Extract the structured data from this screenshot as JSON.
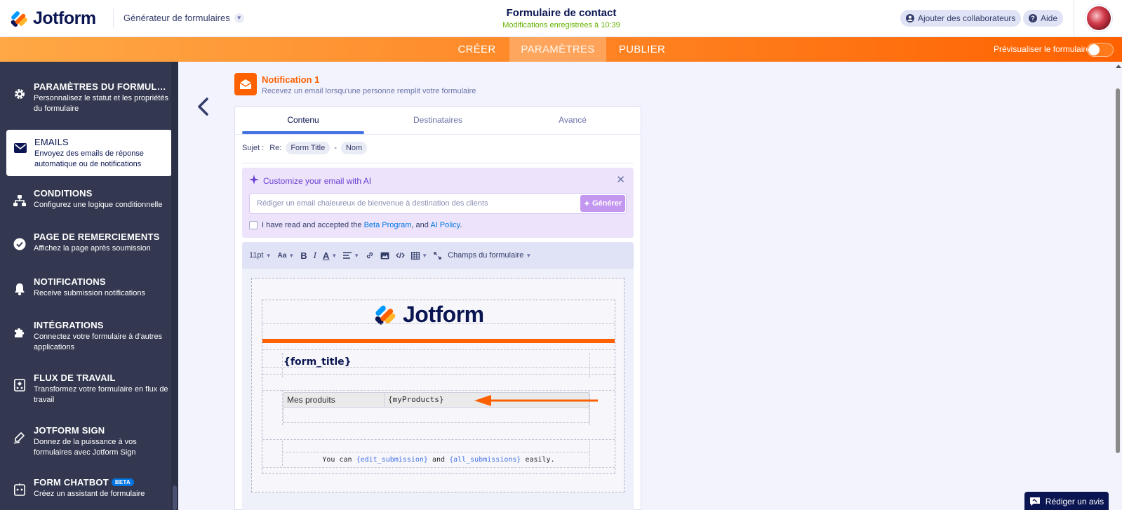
{
  "header": {
    "brand": "Jotform",
    "builder_menu": "Générateur de formulaires",
    "form_title": "Formulaire de contact",
    "saved_status": "Modifications enregistrées à 10:39",
    "add_collaborators": "Ajouter des collaborateurs",
    "help": "Aide"
  },
  "nav": {
    "tabs": [
      "CRÉER",
      "PARAMÈTRES",
      "PUBLIER"
    ],
    "active_tab": "PARAMÈTRES",
    "preview_label": "Prévisualiser le formulaire",
    "preview_enabled": false
  },
  "sidebar": {
    "items": [
      {
        "title": "PARAMÈTRES DU FORMULAIRE",
        "desc": "Personnalisez le statut et les propriétés du formulaire",
        "icon": "gear-icon"
      },
      {
        "title": "EMAILS",
        "desc": "Envoyez des emails de réponse automatique ou de notifications",
        "icon": "envelope-icon",
        "active": true
      },
      {
        "title": "CONDITIONS",
        "desc": "Configurez une logique conditionnelle",
        "icon": "sitemap-icon"
      },
      {
        "title": "PAGE DE REMERCIEMENTS",
        "desc": "Affichez la page après soumission",
        "icon": "check-circle-icon"
      },
      {
        "title": "NOTIFICATIONS",
        "desc": "Receive submission notifications",
        "icon": "bell-icon"
      },
      {
        "title": "INTÉGRATIONS",
        "desc": "Connectez votre formulaire à d'autres applications",
        "icon": "puzzle-icon"
      },
      {
        "title": "FLUX DE TRAVAIL",
        "desc": "Transformez votre formulaire en flux de travail",
        "icon": "workflow-icon"
      },
      {
        "title": "JOTFORM SIGN",
        "desc": "Donnez de la puissance à vos formulaires avec Jotform Sign",
        "icon": "signature-icon"
      },
      {
        "title": "FORM CHATBOT",
        "desc": "Créez un assistant de formulaire",
        "icon": "chatbot-icon",
        "badge": "BETA"
      }
    ]
  },
  "notification": {
    "name": "Notification 1",
    "desc": "Recevez un email lorsqu'une personne remplit votre formulaire",
    "icon": "mail-icon"
  },
  "panel": {
    "tabs": [
      "Contenu",
      "Destinataires",
      "Avancé"
    ],
    "active_tab": "Contenu",
    "subject": {
      "label": "Sujet :",
      "prefix": "Re:",
      "chip1": "Form Title",
      "separator": "-",
      "chip2": "Nom"
    },
    "ai": {
      "title": "Customize your email with AI",
      "placeholder": "Rédiger un email chaleureux de bienvenue à destination des clients",
      "generate": "Générer",
      "terms_prefix": "I have read and accepted the",
      "beta_link": "Beta Program",
      "terms_mid": ", and",
      "policy_link": "AI Policy",
      "terms_end": "."
    },
    "toolbar": {
      "font_size": "11pt",
      "font_family_label": "Aa",
      "bold": "B",
      "italic": "I",
      "text_color": "A",
      "form_fields": "Champs du formulaire"
    },
    "email": {
      "brand": "Jotform",
      "form_title_token": "{form_title}",
      "product_label": "Mes produits",
      "product_token": "{myProducts}",
      "footer_prefix": "You can",
      "edit_token": "{edit_submission}",
      "footer_and": "and",
      "all_token": "{all_submissions}",
      "footer_end": "easily."
    }
  },
  "review_button": "Rédiger un avis",
  "colors": {
    "brand_orange": "#ff6100",
    "navy": "#0a1551",
    "sidebar_bg": "#333850",
    "accent_blue": "#4573e3",
    "ai_purple": "#c397f0"
  }
}
